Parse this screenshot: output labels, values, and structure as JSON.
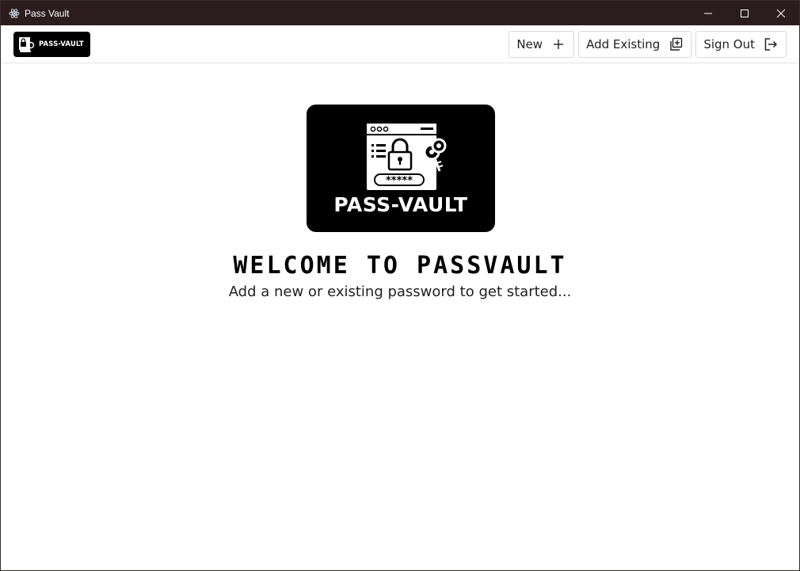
{
  "window": {
    "title": "Pass Vault",
    "app_icon": "atom-icon",
    "controls": [
      "minimize-icon",
      "maximize-icon",
      "close-icon"
    ]
  },
  "header": {
    "logo_text": "PASS-VAULT",
    "buttons": [
      {
        "label": "New",
        "icon": "plus-icon"
      },
      {
        "label": "Add Existing",
        "icon": "add-box-icon"
      },
      {
        "label": "Sign Out",
        "icon": "sign-out-icon"
      }
    ]
  },
  "main": {
    "hero_logo_text": "PASS-VAULT",
    "heading": "WELCOME TO PASSVAULT",
    "subtitle": "Add a new or existing password to get started..."
  },
  "colors": {
    "titlebar_bg": "#2b1d1e",
    "logo_bg": "#000000",
    "text": "#222222"
  }
}
